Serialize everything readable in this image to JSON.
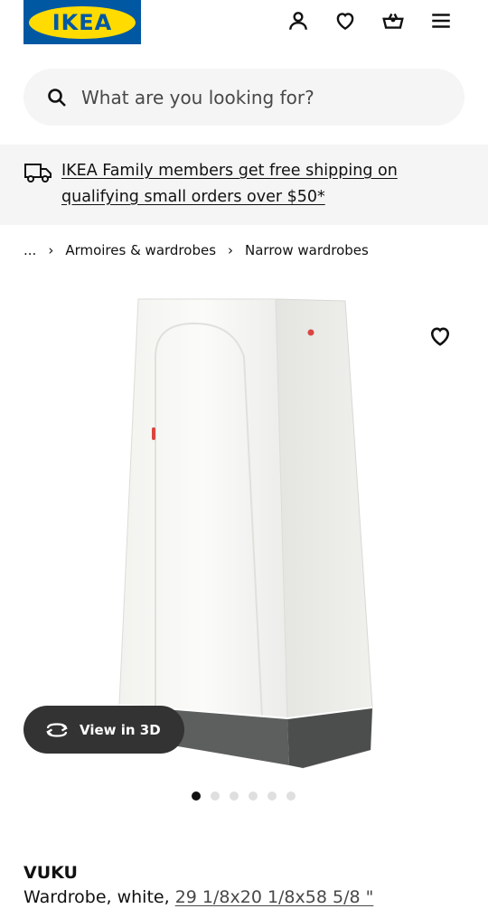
{
  "header": {
    "logo_text": "IKEA",
    "icons": [
      "account-icon",
      "heart-icon",
      "basket-icon",
      "menu-icon"
    ]
  },
  "search": {
    "placeholder": "What are you looking for?"
  },
  "promo": {
    "text": "IKEA Family members get free shipping on qualifying small orders over $50*"
  },
  "breadcrumb": {
    "ellipsis": "...",
    "items": [
      "Armoires & wardrobes",
      "Narrow wardrobes"
    ]
  },
  "gallery": {
    "view_3d_label": "View in 3D",
    "dot_count": 6,
    "active_dot": 0
  },
  "product": {
    "name": "VUKU",
    "description": "Wardrobe, white,",
    "measurements": "29 1/8x20 1/8x58 5/8 \""
  },
  "colors": {
    "ikea_blue": "#0058a3",
    "ikea_yellow": "#ffdb00",
    "text": "#111111",
    "surface": "#f5f5f5"
  }
}
